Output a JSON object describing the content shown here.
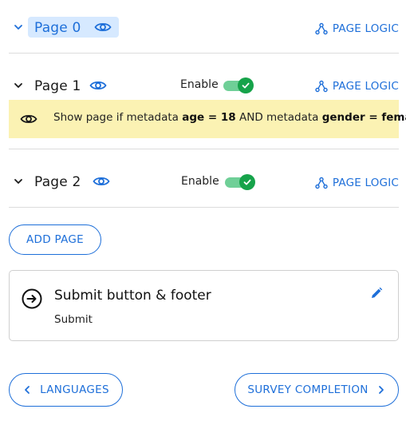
{
  "pages": [
    {
      "title": "Page 0",
      "logic_label": "PAGE LOGIC",
      "selected": true
    },
    {
      "title": "Page 1",
      "logic_label": "PAGE LOGIC",
      "enable_label": "Enable",
      "enabled": true
    },
    {
      "title": "Page 2",
      "logic_label": "PAGE LOGIC",
      "enable_label": "Enable",
      "enabled": true
    }
  ],
  "condition": {
    "prefix": "Show page if metadata ",
    "rule1": "age = 18",
    "joiner": " AND metadata ",
    "rule2": "gender = female"
  },
  "add_page_label": "ADD PAGE",
  "submit_card": {
    "title": "Submit button & footer",
    "subtitle": "Submit"
  },
  "nav": {
    "back_label": "LANGUAGES",
    "next_label": "SURVEY COMPLETION"
  },
  "colors": {
    "accent": "#1e6fd9",
    "selected_bg": "#d6e9ff",
    "condition_bg": "#fbf2b3",
    "toggle_on": "#16a34a"
  },
  "icons": [
    "chevron-down-icon",
    "eye-icon",
    "page-logic-icon",
    "check-icon",
    "arrow-right-circle-icon",
    "pencil-icon",
    "chevron-left-icon",
    "chevron-right-icon"
  ]
}
